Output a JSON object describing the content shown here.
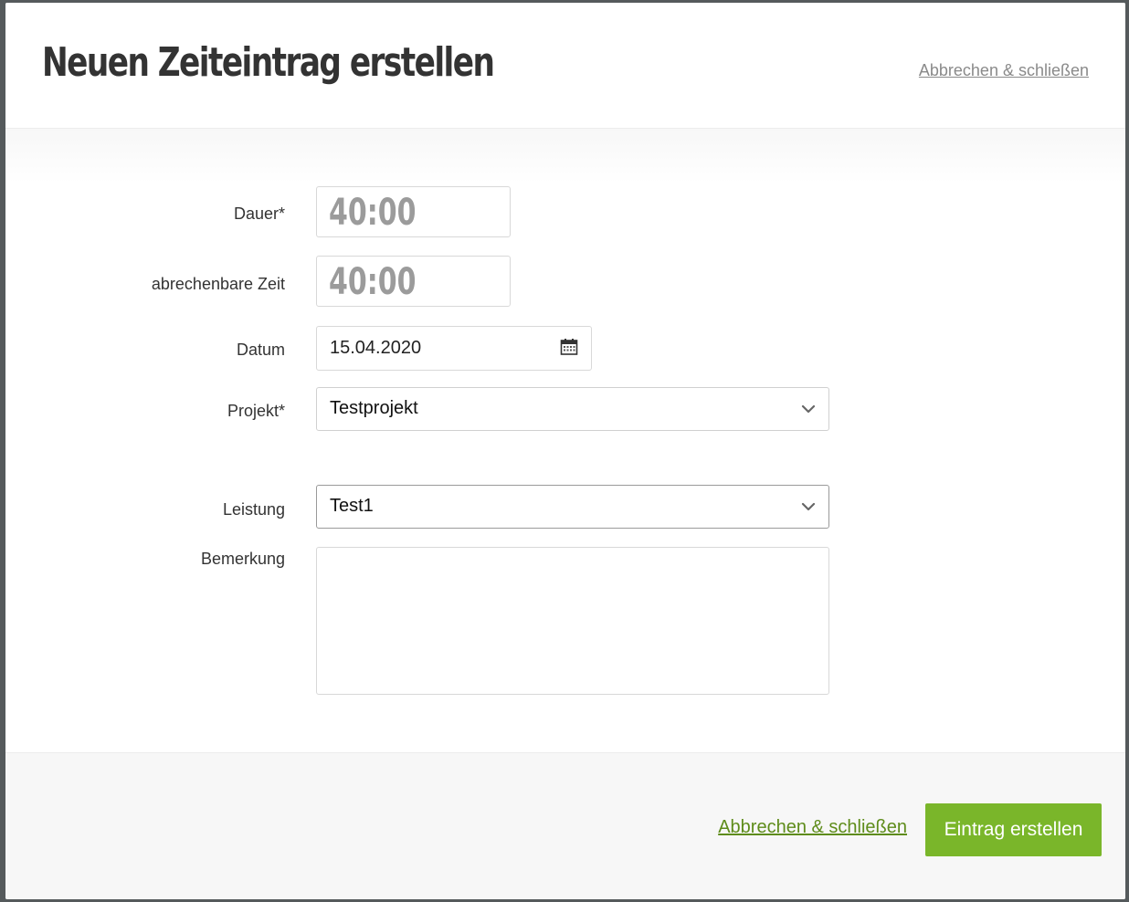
{
  "modal": {
    "title": "Neuen Zeiteintrag erstellen",
    "header_cancel_label": "Abbrechen & schließen"
  },
  "form": {
    "duration": {
      "label": "Dauer*",
      "value": "40:00"
    },
    "billable_time": {
      "label": "abrechenbare Zeit",
      "value": "40:00"
    },
    "date": {
      "label": "Datum",
      "value": "15.04.2020",
      "icon": "calendar-icon"
    },
    "project": {
      "label": "Projekt*",
      "selected": "Testprojekt",
      "icon": "chevron-down-icon"
    },
    "service": {
      "label": "Leistung",
      "selected": "Test1",
      "icon": "chevron-down-icon"
    },
    "remark": {
      "label": "Bemerkung",
      "value": ""
    }
  },
  "footer": {
    "cancel_label": "Abbrechen & schließen",
    "submit_label": "Eintrag erstellen"
  },
  "colors": {
    "accent": "#7ab62a",
    "link_green": "#5e8c1a",
    "title_text": "#333333",
    "muted_time": "#9b9b9b"
  }
}
